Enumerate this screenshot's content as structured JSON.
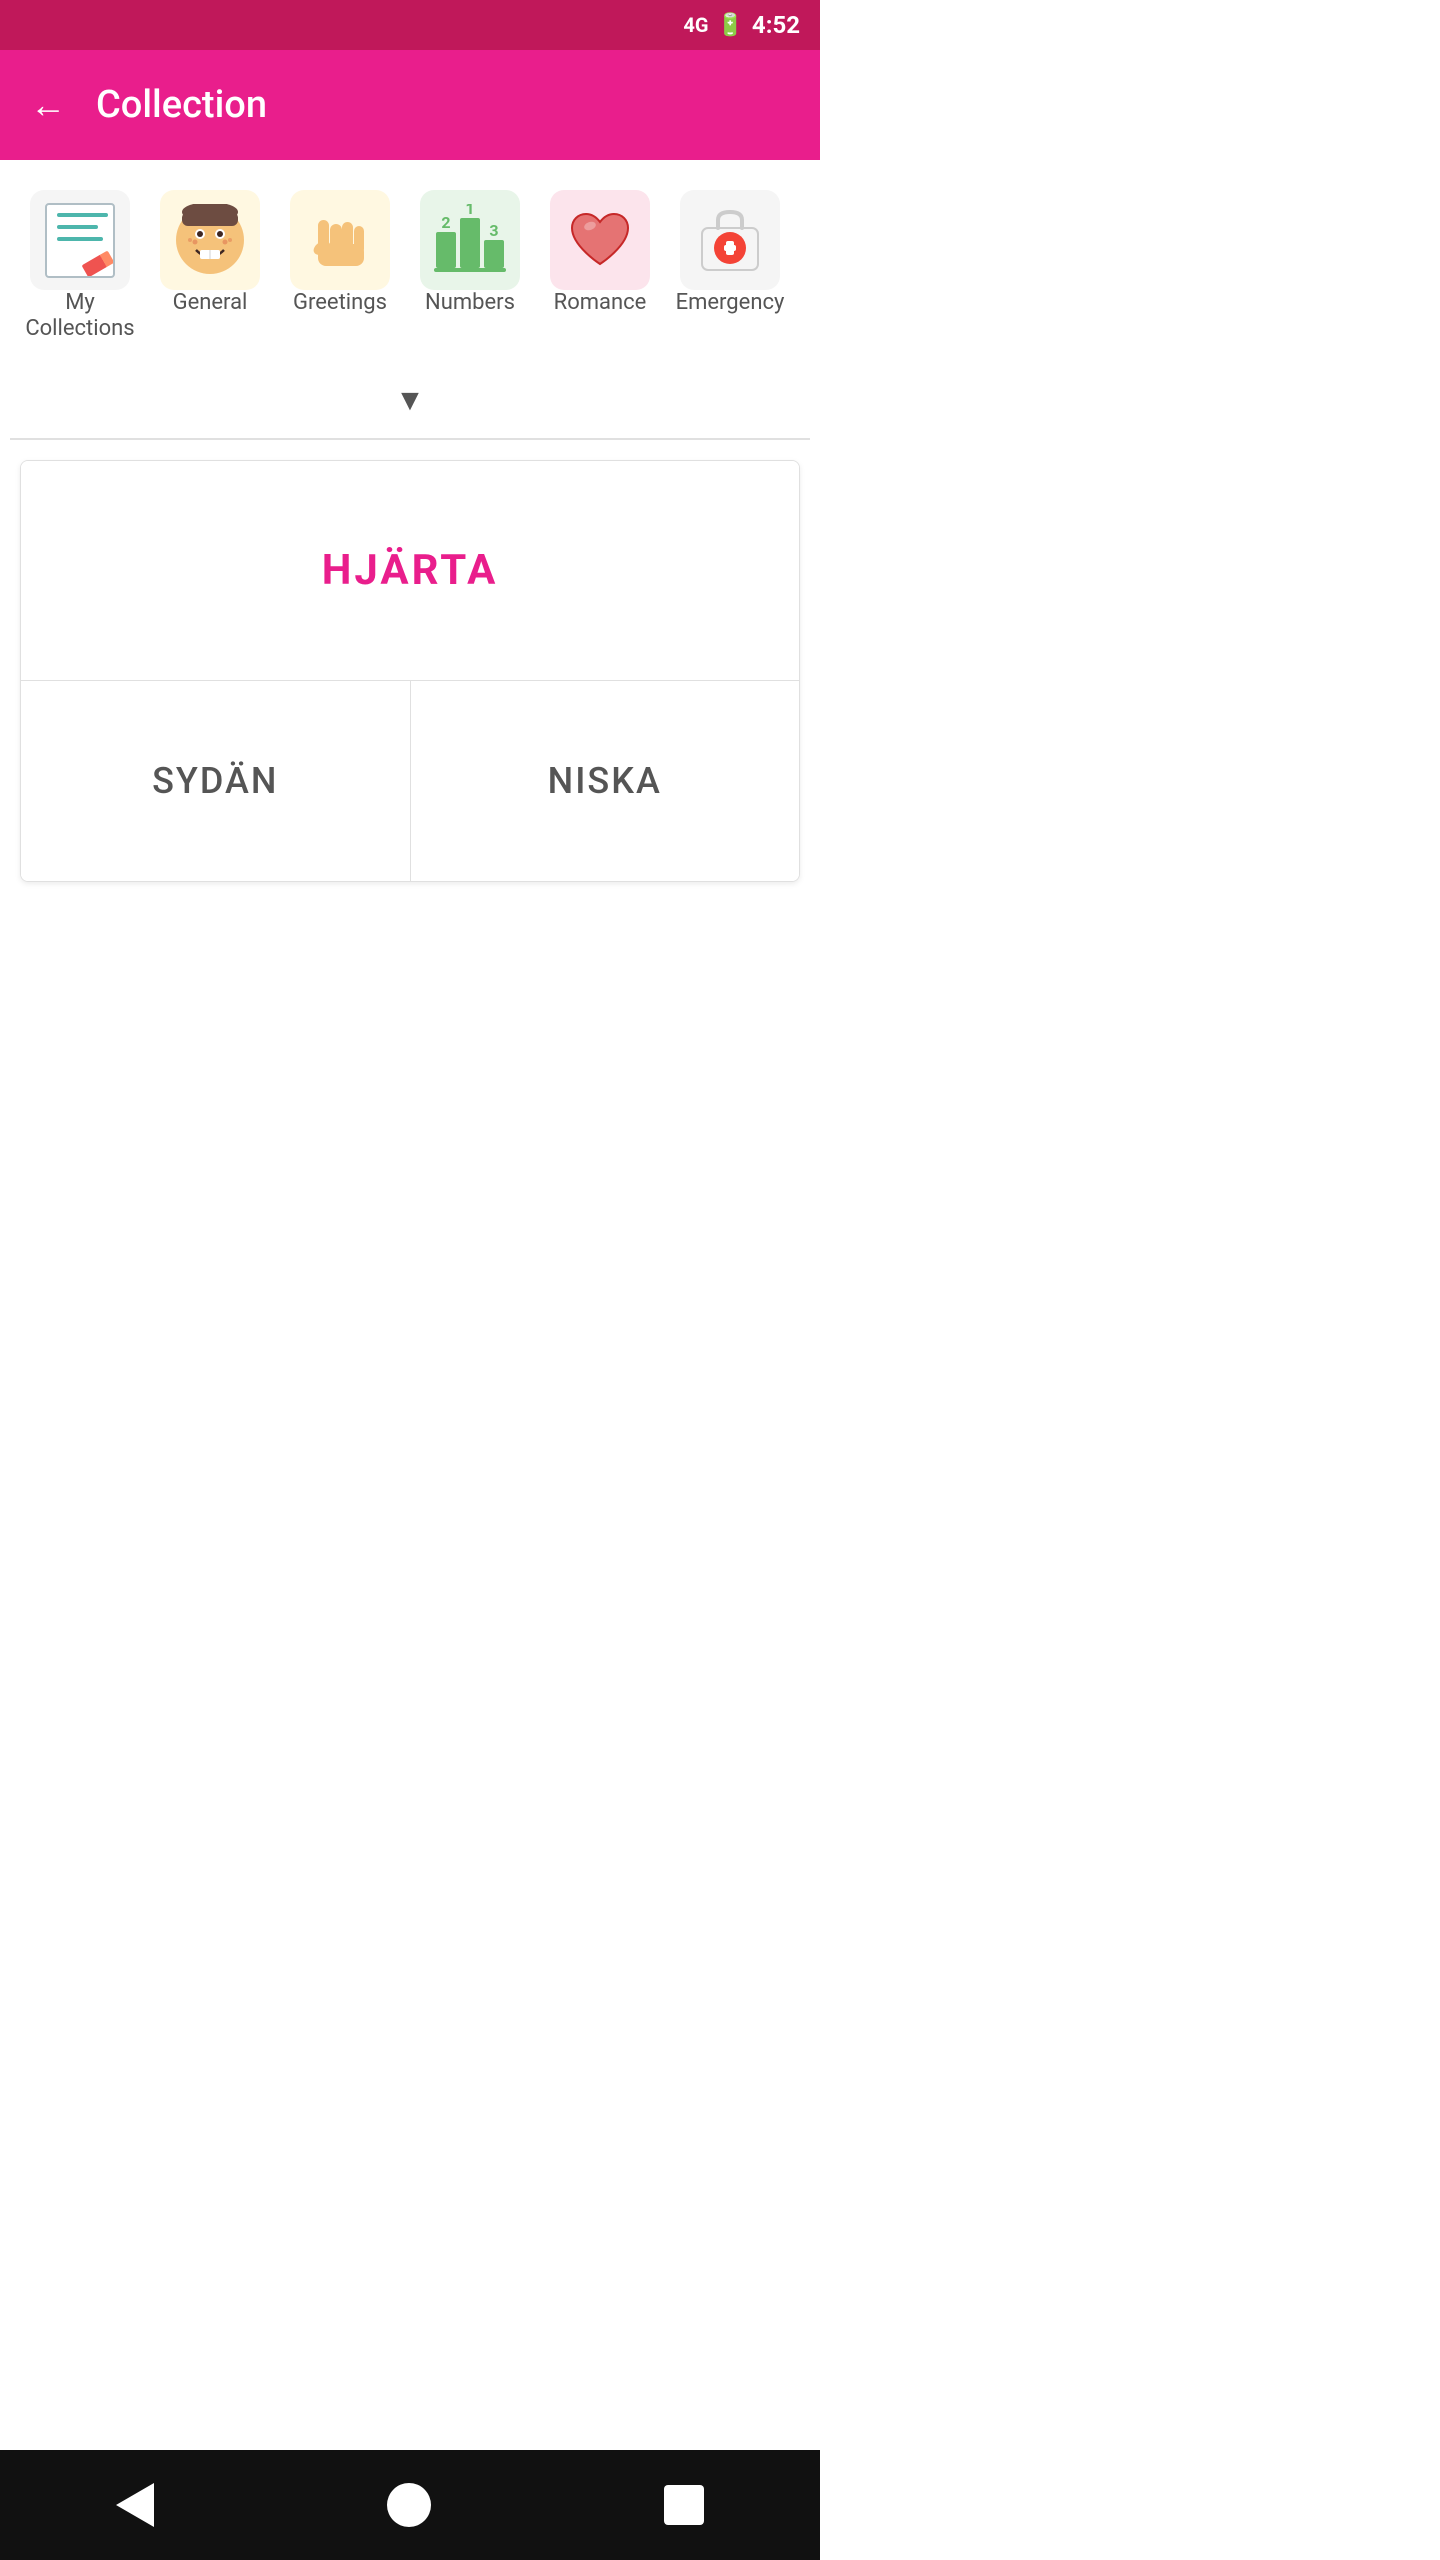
{
  "statusBar": {
    "time": "4:52",
    "signal": "4G",
    "battery": "⚡"
  },
  "header": {
    "title": "Collection",
    "backLabel": "←"
  },
  "categories": [
    {
      "id": "my-collections",
      "label": "My Collections",
      "icon": "notebook",
      "type": "custom"
    },
    {
      "id": "general",
      "label": "General",
      "icon": "😊",
      "type": "emoji"
    },
    {
      "id": "greetings",
      "label": "Greetings",
      "icon": "🤚",
      "type": "emoji"
    },
    {
      "id": "numbers",
      "label": "Numbers",
      "icon": "numbers",
      "type": "numbers"
    },
    {
      "id": "romance",
      "label": "Romance",
      "icon": "❤️",
      "type": "emoji"
    },
    {
      "id": "emergency",
      "label": "Emergency",
      "icon": "🏥",
      "type": "emoji"
    }
  ],
  "chevron": "▼",
  "flashcard": {
    "mainWord": "HJÄRTA",
    "option1": "SYDÄN",
    "option2": "NISKA"
  },
  "navBar": {
    "back": "back",
    "home": "home",
    "recent": "recent"
  }
}
